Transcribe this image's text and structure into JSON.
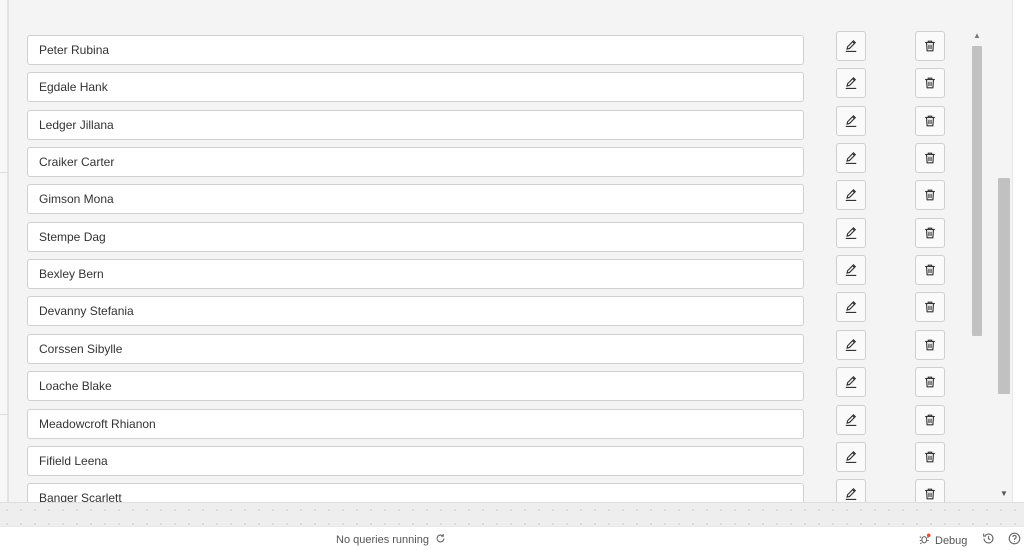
{
  "list": {
    "rows": [
      {
        "name": "Peter Rubina"
      },
      {
        "name": "Egdale Hank"
      },
      {
        "name": "Ledger Jillana"
      },
      {
        "name": "Craiker Carter"
      },
      {
        "name": "Gimson Mona"
      },
      {
        "name": "Stempe Dag"
      },
      {
        "name": "Bexley Bern"
      },
      {
        "name": "Devanny Stefania"
      },
      {
        "name": "Corssen Sibylle"
      },
      {
        "name": "Loache Blake"
      },
      {
        "name": "Meadowcroft Rhianon"
      },
      {
        "name": "Fifield Leena"
      },
      {
        "name": "Banger Scarlett"
      }
    ],
    "edit_icon": "pencil-icon",
    "delete_icon": "trash-icon"
  },
  "status": {
    "queries": "No queries running",
    "debug_label": "Debug"
  },
  "colors": {
    "debug_dot": "#e74c3c",
    "border": "#d0d0d0"
  }
}
